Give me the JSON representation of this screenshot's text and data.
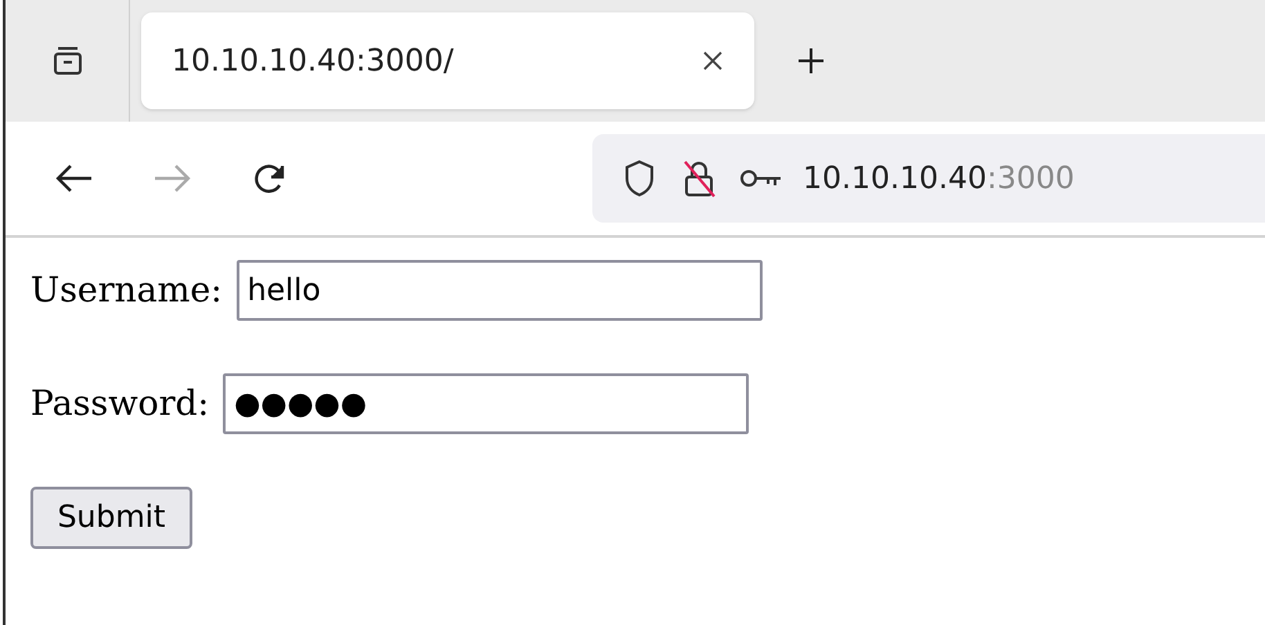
{
  "tabs": [
    {
      "title": "10.10.10.40:3000/",
      "selected": true
    }
  ],
  "address_bar": {
    "host": "10.10.10.40",
    "port": ":3000"
  },
  "nav": {
    "back_disabled": false,
    "forward_disabled": true
  },
  "form": {
    "fields": [
      {
        "label": "Username:",
        "value": "hello"
      },
      {
        "label": "Password:",
        "value": "●●●●●"
      }
    ],
    "submit": "Submit"
  }
}
